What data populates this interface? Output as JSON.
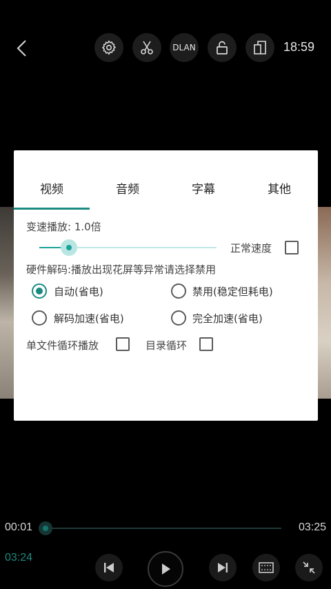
{
  "topbar": {
    "dlan_label": "DLAN",
    "clock": "18:59",
    "icons": [
      "back-icon",
      "settings-icon",
      "scissors-icon",
      "dlan-icon",
      "unlock-icon",
      "rotate-icon"
    ]
  },
  "dialog": {
    "tabs": [
      {
        "label": "视频",
        "active": true
      },
      {
        "label": "音频",
        "active": false
      },
      {
        "label": "字幕",
        "active": false
      },
      {
        "label": "其他",
        "active": false
      }
    ],
    "speed_label": "变速播放:  1.0倍",
    "speed_value": 1.0,
    "normal_speed_label": "正常速度",
    "normal_speed_checked": false,
    "hw_decode_label": "硬件解码:播放出现花屏等异常请选择禁用",
    "decode_options": [
      {
        "label": "自动(省电)",
        "checked": true
      },
      {
        "label": "禁用(稳定但耗电)",
        "checked": false
      },
      {
        "label": "解码加速(省电)",
        "checked": false
      },
      {
        "label": "完全加速(省电)",
        "checked": false
      }
    ],
    "single_loop_label": "单文件循环播放",
    "single_loop_checked": false,
    "dir_loop_label": "目录循环",
    "dir_loop_checked": false
  },
  "player": {
    "current_time": "00:01",
    "total_time": "03:25",
    "remaining_time": "03:24",
    "progress_fraction": 0.005
  },
  "colors": {
    "accent": "#1a8a80",
    "dialog_bg": "#ffffff",
    "background": "#000000"
  }
}
